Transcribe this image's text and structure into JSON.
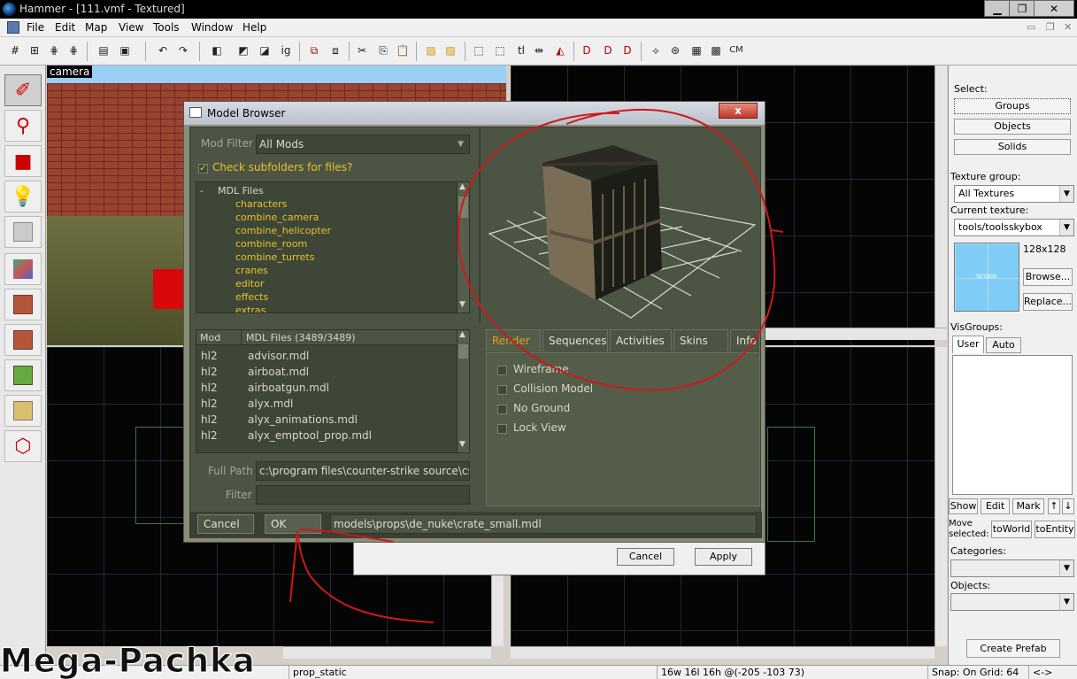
{
  "window": {
    "title": "Hammer - [111.vmf - Textured]",
    "minimize": "▁",
    "maximize": "❐",
    "close": "✕"
  },
  "menu": [
    "File",
    "Edit",
    "Map",
    "View",
    "Tools",
    "Window",
    "Help"
  ],
  "viewport_camera_label": "camera",
  "model_browser": {
    "title": "Model Browser",
    "close": "x",
    "mod_filter_label": "Mod Filter",
    "mod_filter_value": "All Mods",
    "check_subfolders": "Check subfolders for files?",
    "tree_root": "MDL Files",
    "tree_toggle": "-",
    "folders": [
      "characters",
      "combine_camera",
      "combine_helicopter",
      "combine_room",
      "combine_turrets",
      "cranes",
      "editor",
      "effects",
      "extras"
    ],
    "list_headers": {
      "mod": "Mod",
      "files": "MDL Files (3489/3489)"
    },
    "files": [
      {
        "mod": "hl2",
        "file": "advisor.mdl"
      },
      {
        "mod": "hl2",
        "file": "airboat.mdl"
      },
      {
        "mod": "hl2",
        "file": "airboatgun.mdl"
      },
      {
        "mod": "hl2",
        "file": "alyx.mdl"
      },
      {
        "mod": "hl2",
        "file": "alyx_animations.mdl"
      },
      {
        "mod": "hl2",
        "file": "alyx_emptool_prop.mdl"
      }
    ],
    "full_path_label": "Full Path",
    "full_path_value": "c:\\program files\\counter-strike source\\cst",
    "filter_label": "Filter",
    "filter_value": "",
    "tabs": [
      "Render",
      "Sequences",
      "Activities",
      "Skins",
      "Info"
    ],
    "render_options": [
      "Wireframe",
      "Collision Model",
      "No Ground",
      "Lock View"
    ],
    "cancel": "Cancel",
    "ok": "OK",
    "selected_model": "models\\props\\de_nuke\\crate_small.mdl"
  },
  "props_dialog": {
    "cancel": "Cancel",
    "apply": "Apply"
  },
  "right_panel": {
    "select_label": "Select:",
    "groups": "Groups",
    "objects": "Objects",
    "solids": "Solids",
    "texture_group_label": "Texture group:",
    "texture_group_value": "All Textures",
    "current_texture_label": "Current texture:",
    "current_texture_value": "tools/toolsskybox",
    "texture_size": "128x128",
    "texture_thumb_text": "SKYBOX",
    "browse": "Browse...",
    "replace": "Replace...",
    "visgroups_label": "VisGroups:",
    "vis_tabs": [
      "User",
      "Auto"
    ],
    "show": "Show",
    "edit": "Edit",
    "mark": "Mark",
    "up": "↑",
    "down": "↓",
    "move_selected": "Move selected:",
    "to_world": "toWorld",
    "to_entity": "toEntity",
    "categories_label": "Categories:",
    "objects_label": "Objects:",
    "create_prefab": "Create Prefab"
  },
  "status": {
    "entity": "prop_static",
    "size": "16w 16l 16h @(-205 -103 73)",
    "snap": "Snap: On Grid: 64",
    "arrows": "<->"
  },
  "watermark": "Mega-Pachka",
  "colors": {
    "dialog_bg": "#4c5444",
    "folder_text": "#e8c22a",
    "annotation": "#d01818"
  }
}
